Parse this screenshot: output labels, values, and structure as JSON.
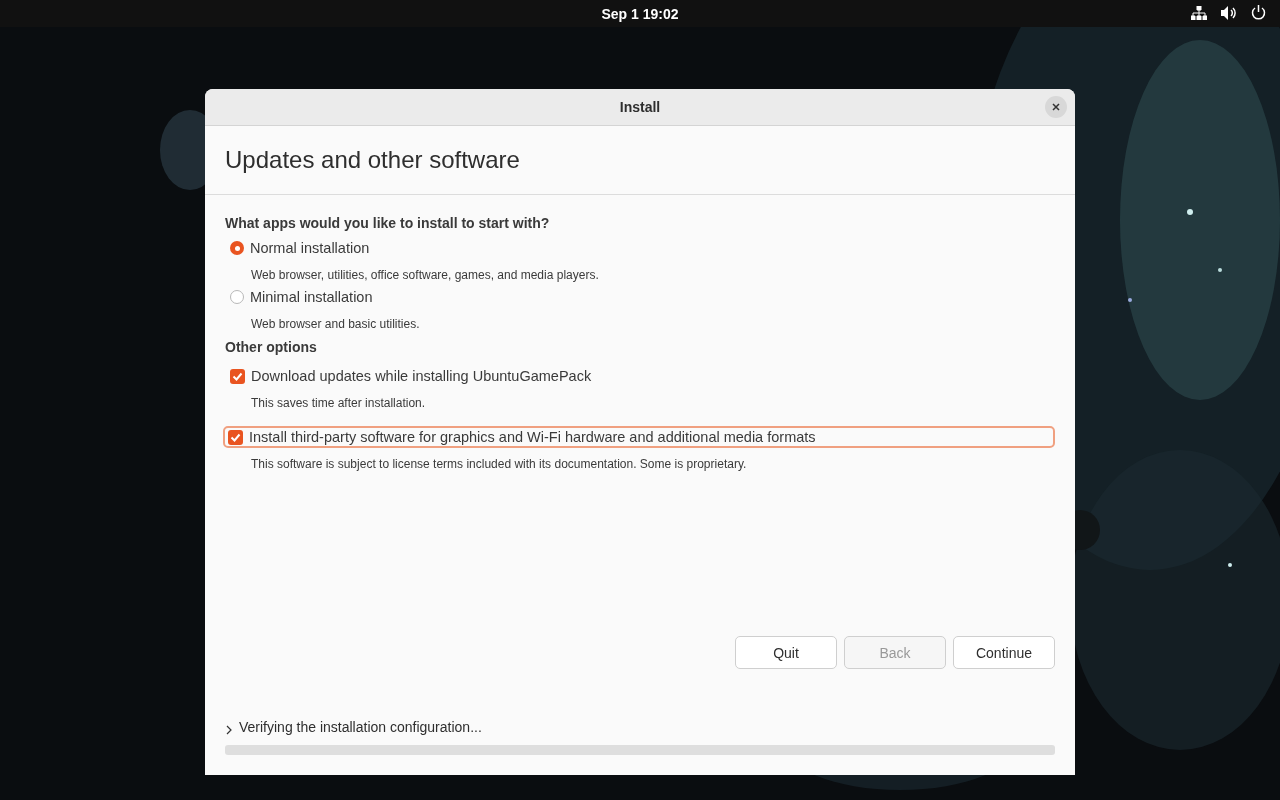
{
  "top_bar": {
    "clock": "Sep 1  19:02"
  },
  "window": {
    "title": "Install"
  },
  "page_title": "Updates and other software",
  "install_type": {
    "heading": "What apps would you like to install to start with?",
    "options": [
      {
        "label": "Normal installation",
        "description": "Web browser, utilities, office software, games, and media players.",
        "selected": true
      },
      {
        "label": "Minimal installation",
        "description": "Web browser and basic utilities.",
        "selected": false
      }
    ]
  },
  "other_options": {
    "heading": "Other options",
    "options": [
      {
        "label": "Download updates while installing UbuntuGamePack",
        "description": "This saves time after installation.",
        "checked": true,
        "focused": false
      },
      {
        "label": "Install third-party software for graphics and Wi-Fi hardware and additional media formats",
        "description": "This software is subject to license terms included with its documentation. Some is proprietary.",
        "checked": true,
        "focused": true
      }
    ]
  },
  "buttons": [
    {
      "label": "Quit",
      "disabled": false
    },
    {
      "label": "Back",
      "disabled": true
    },
    {
      "label": "Continue",
      "disabled": false
    }
  ],
  "status": {
    "text": "Verifying the installation configuration...",
    "expanded": false,
    "level": 0
  }
}
